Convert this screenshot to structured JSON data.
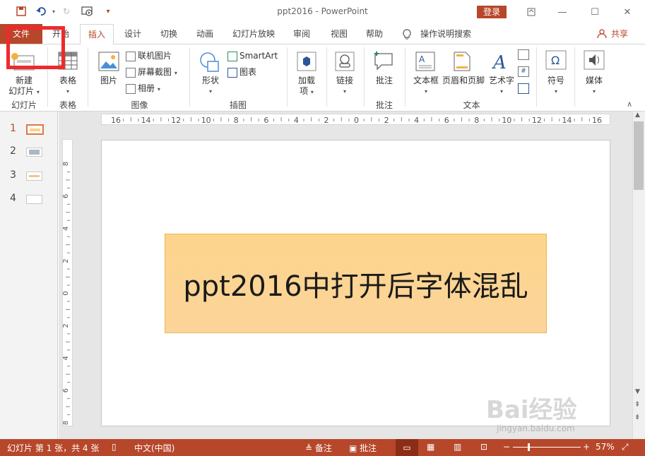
{
  "window": {
    "title": "ppt2016  -  PowerPoint",
    "login_label": "登录"
  },
  "tabs": [
    {
      "label": "文件"
    },
    {
      "label": "开始"
    },
    {
      "label": "插入"
    },
    {
      "label": "设计"
    },
    {
      "label": "切换"
    },
    {
      "label": "动画"
    },
    {
      "label": "幻灯片放映"
    },
    {
      "label": "审阅"
    },
    {
      "label": "视图"
    },
    {
      "label": "帮助"
    },
    {
      "label": "操作说明搜索"
    },
    {
      "label": "共享"
    }
  ],
  "ribbon": {
    "new_slide": "新建\n幻灯片",
    "new_slide_line1": "新建",
    "new_slide_line2": "幻灯片",
    "group_slides": "幻灯片",
    "table": "表格",
    "group_table": "表格",
    "picture": "图片",
    "online_pictures": "联机图片",
    "screenshot": "屏幕截图",
    "album": "相册",
    "group_images": "图像",
    "shapes": "形状",
    "smartart": "SmartArt",
    "chart": "图表",
    "group_illustrations": "插图",
    "addins_line1": "加载",
    "addins_line2": "项",
    "links": "链接",
    "comment": "批注",
    "group_comments": "批注",
    "textbox": "文本框",
    "header_footer": "页眉和页脚",
    "wordart": "艺术字",
    "group_text": "文本",
    "symbols": "符号",
    "media": "媒体"
  },
  "slides": [
    {
      "number": "1"
    },
    {
      "number": "2"
    },
    {
      "number": "3"
    },
    {
      "number": "4"
    }
  ],
  "rulers": {
    "horizontal": [
      "16",
      "14",
      "12",
      "10",
      "8",
      "6",
      "4",
      "2",
      "0",
      "2",
      "4",
      "6",
      "8",
      "10",
      "12",
      "14",
      "16"
    ],
    "vertical": [
      "8",
      "6",
      "4",
      "2",
      "0",
      "2",
      "4",
      "6",
      "8"
    ]
  },
  "slide": {
    "text": "ppt2016中打开后字体混乱"
  },
  "status": {
    "slide_info": "幻灯片 第 1 张，共 4 张",
    "language": "中文(中国)",
    "notes": "备注",
    "comments": "批注",
    "zoom": "57%"
  },
  "watermark": {
    "text": "Bai经验",
    "url": "jingyan.baidu.com"
  },
  "colors": {
    "accent": "#b7472a",
    "highlight_box": "#ee2a2a",
    "textbox_fill": "#fdd48c"
  }
}
